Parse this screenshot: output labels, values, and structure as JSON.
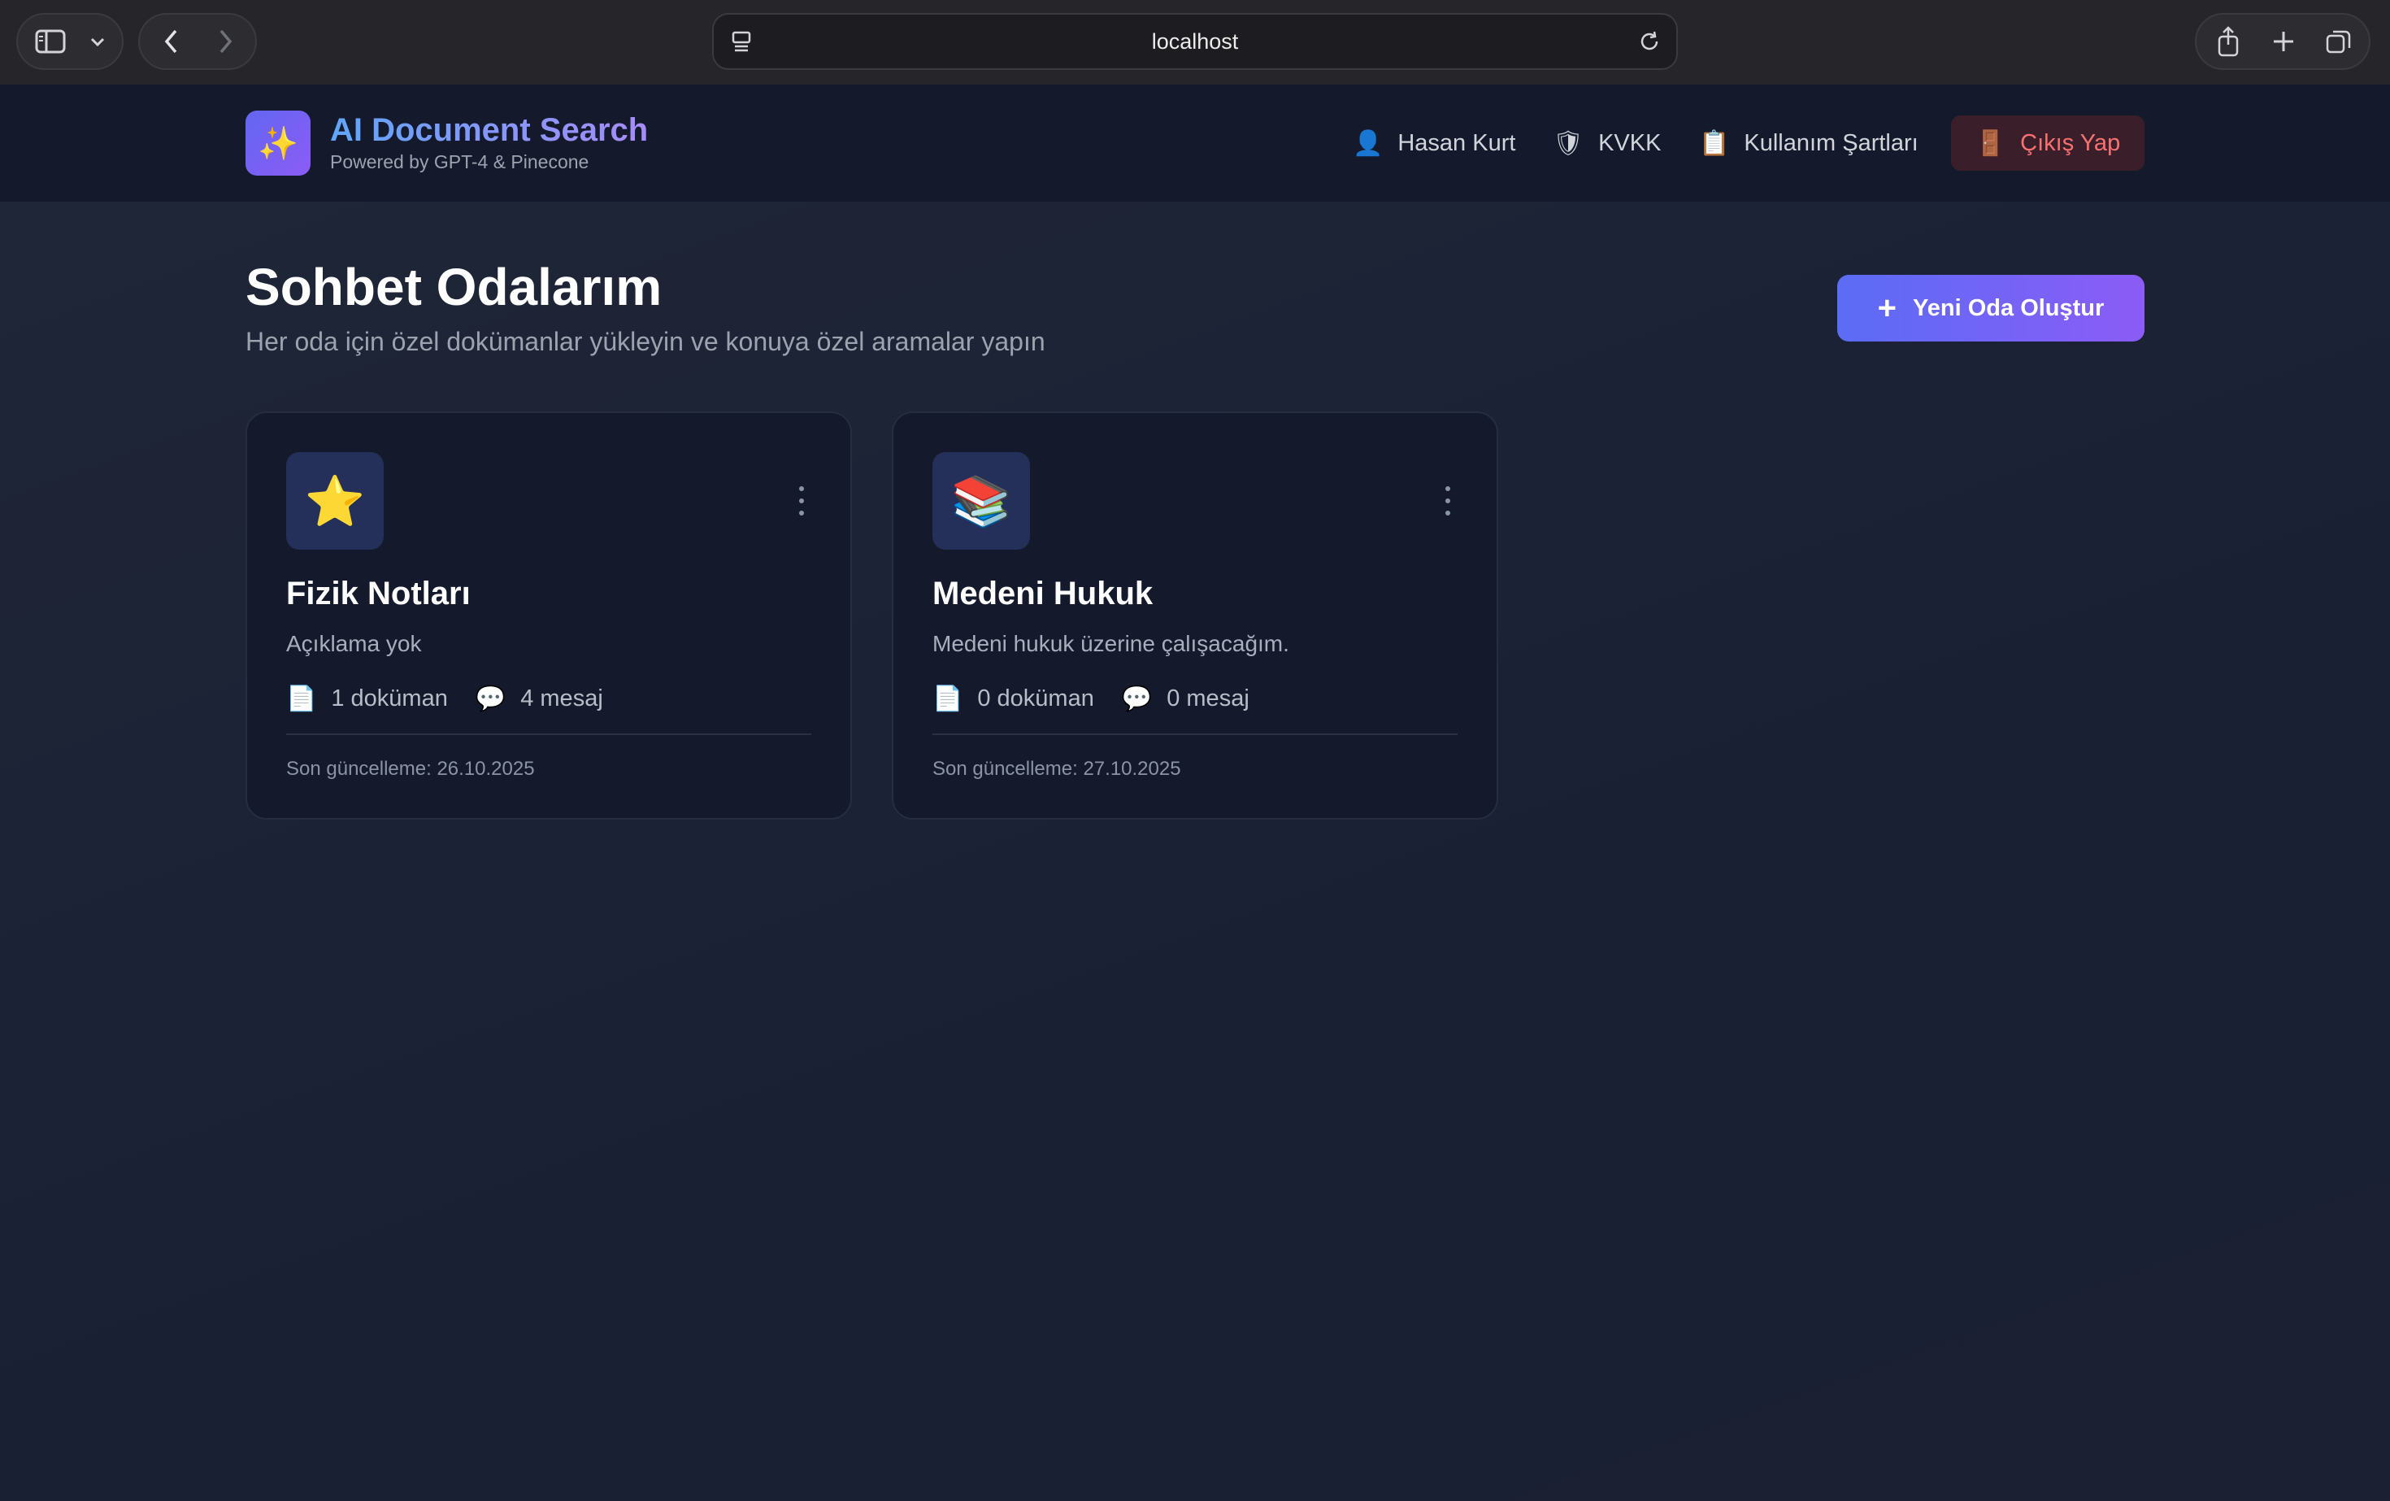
{
  "browser": {
    "url": "localhost",
    "icons": {
      "sidebar": "sidebar-icon",
      "chevron": "chevron-down-icon",
      "back": "back-icon",
      "forward": "forward-icon",
      "reader": "reader-icon",
      "reload": "reload-icon",
      "share": "share-icon",
      "new_tab": "plus-icon",
      "tabs": "tabs-icon"
    }
  },
  "header": {
    "logo_icon": "✨",
    "title": "AI Document Search",
    "subtitle": "Powered by GPT-4 & Pinecone",
    "nav": [
      {
        "icon": "👤",
        "label": "Hasan Kurt"
      },
      {
        "icon": "🛡",
        "label": "KVKK"
      },
      {
        "icon": "📋",
        "label": "Kullanım Şartları"
      }
    ],
    "logout": {
      "icon": "🚪",
      "label": "Çıkış Yap"
    }
  },
  "main": {
    "title": "Sohbet Odalarım",
    "subtitle": "Her oda için özel dokümanlar yükleyin ve konuya özel aramalar yapın",
    "new_room_label": "Yeni Oda Oluştur",
    "new_room_icon": "+",
    "rooms": [
      {
        "icon": "⭐",
        "name": "Fizik Notları",
        "description": "Açıklama yok",
        "documents": "1 doküman",
        "messages": "4 mesaj",
        "updated": "Son güncelleme: 26.10.2025"
      },
      {
        "icon": "📚",
        "name": "Medeni Hukuk",
        "description": "Medeni hukuk üzerine çalışacağım.",
        "documents": "0 doküman",
        "messages": "0 mesaj",
        "updated": "Son güncelleme: 27.10.2025"
      }
    ],
    "stat_icons": {
      "document": "📄",
      "message": "💬"
    }
  },
  "colors": {
    "accent": "#6366f1",
    "accent_end": "#8b5cf6",
    "logout_text": "#f87171",
    "background": "#1c2233"
  }
}
